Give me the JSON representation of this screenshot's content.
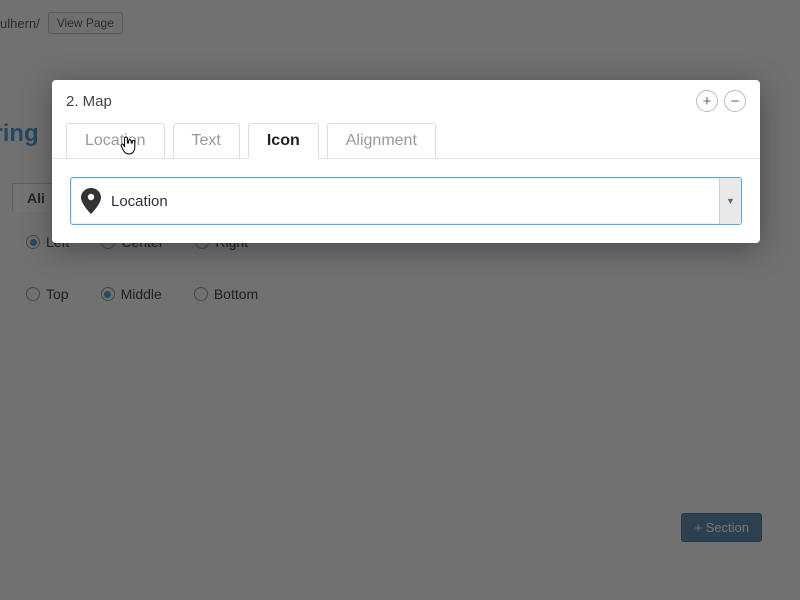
{
  "bg": {
    "url_fragment": "ulhern/",
    "view_button": "View Page",
    "title": "aring",
    "tab_label": "Ali",
    "radios_h": [
      {
        "label": "Left",
        "selected": true
      },
      {
        "label": "Center",
        "selected": false
      },
      {
        "label": "Right",
        "selected": false
      }
    ],
    "radios_v": [
      {
        "label": "Top",
        "selected": false
      },
      {
        "label": "Middle",
        "selected": true
      },
      {
        "label": "Bottom",
        "selected": false
      }
    ],
    "add_section": "+ Section"
  },
  "modal": {
    "title": "2. Map",
    "plus": "+",
    "minus": "−",
    "tabs": [
      {
        "label": "Location",
        "active": false
      },
      {
        "label": "Text",
        "active": false
      },
      {
        "label": "Icon",
        "active": true
      },
      {
        "label": "Alignment",
        "active": false
      }
    ],
    "select": {
      "value": "Location"
    }
  }
}
